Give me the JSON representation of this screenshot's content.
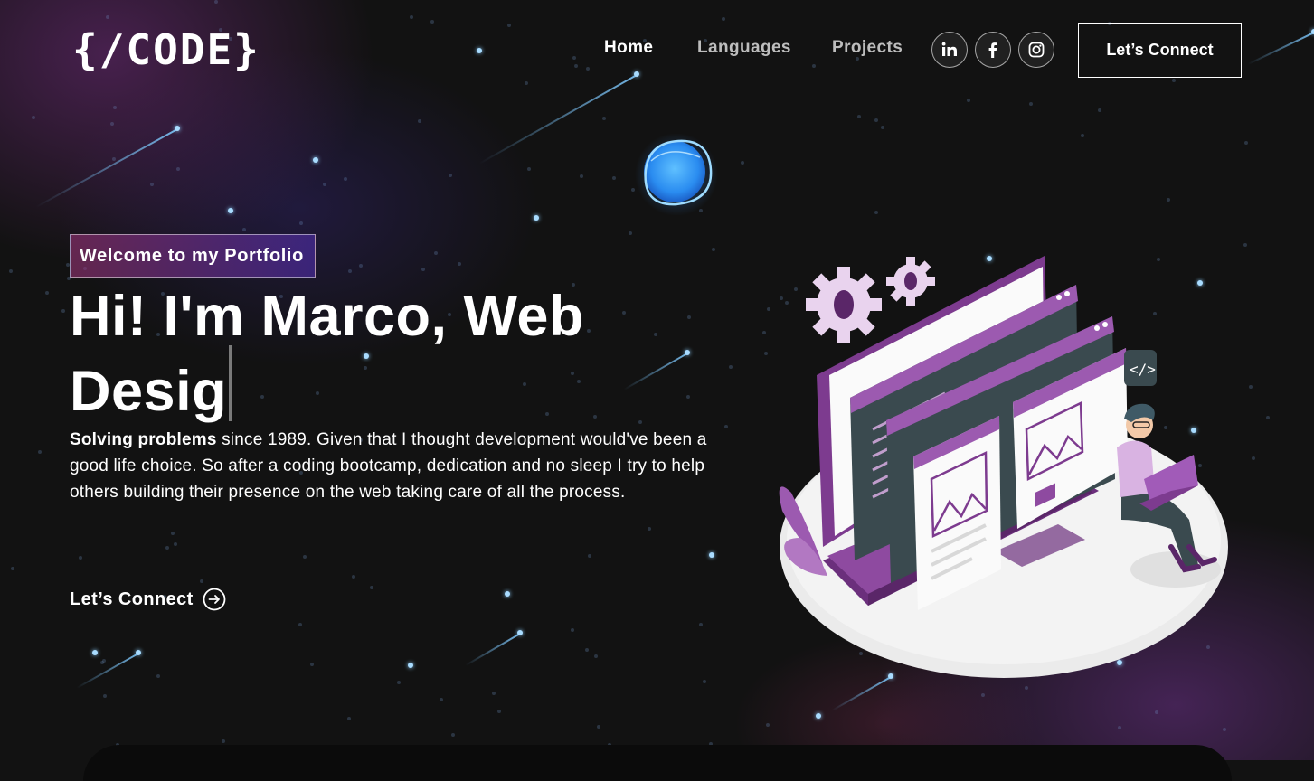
{
  "logo": {
    "text": "{/CODE}"
  },
  "nav": {
    "items": [
      "Home",
      "Languages",
      "Projects"
    ]
  },
  "social": [
    {
      "name": "linkedin-icon"
    },
    {
      "name": "facebook-icon"
    },
    {
      "name": "instagram-icon"
    }
  ],
  "header_cta": "Let’s Connect",
  "hero": {
    "tagline": "Welcome to my Portfolio",
    "headline": "Hi! I'm Marco, Web Desig",
    "desc_bold": "Solving problems",
    "desc_rest": " since 1989. Given that I thought development would've been a good life choice. So after a coding bootcamp, dedication and no sleep I try to help others building their presence on the web taking care of all the process.",
    "cta": "Let’s Connect"
  },
  "colors": {
    "background": "#121212",
    "accent_pink": "#aa367c",
    "accent_purple": "#4a2fbd",
    "illustration_purple": "#8e4aa0"
  }
}
